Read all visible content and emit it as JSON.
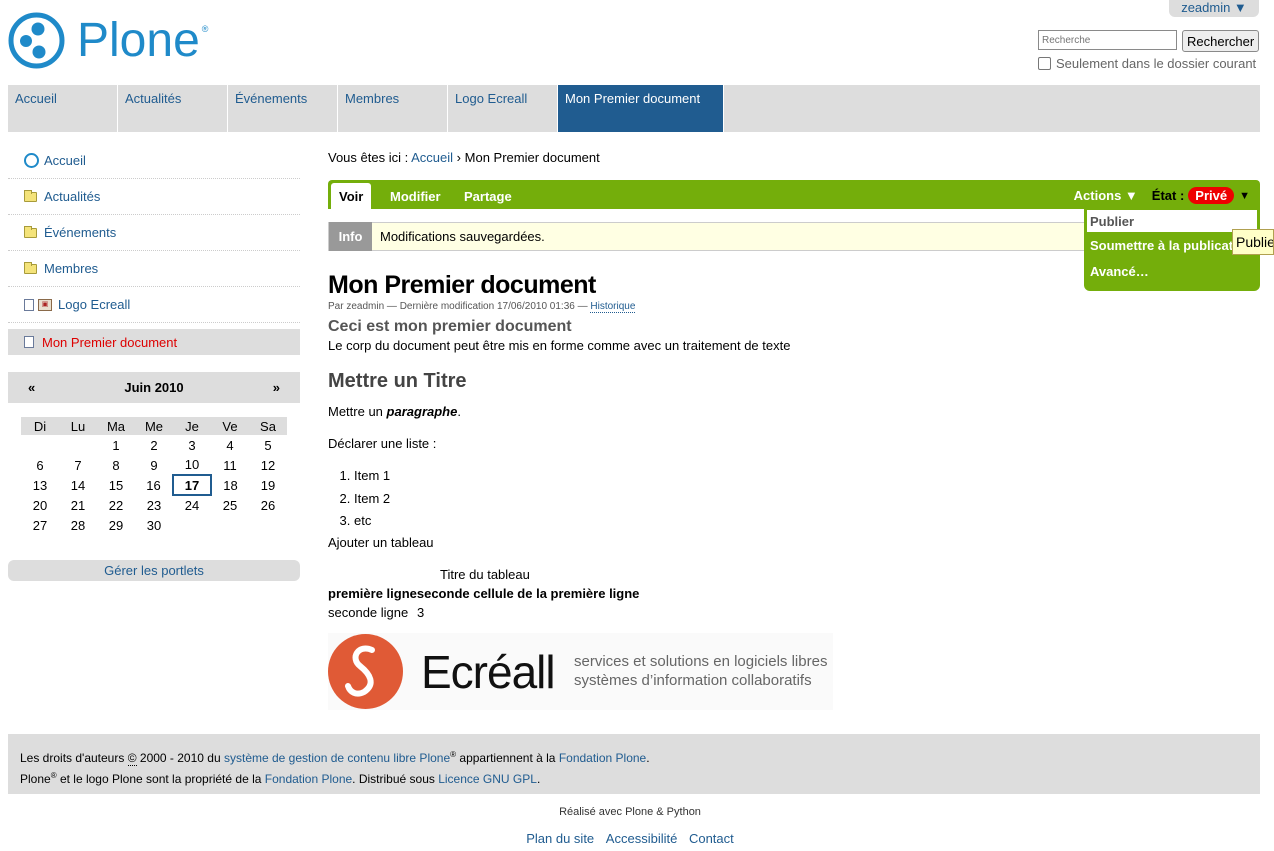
{
  "header": {
    "logo_text": "Plone",
    "logo_reg": "®",
    "user_menu": "zeadmin ▼",
    "search_placeholder": "Recherche",
    "search_button": "Rechercher",
    "search_option": "Seulement dans le dossier courant"
  },
  "globalnav": {
    "tabs": [
      {
        "label": "Accueil"
      },
      {
        "label": "Actualités"
      },
      {
        "label": "Événements"
      },
      {
        "label": "Membres"
      },
      {
        "label": "Logo Ecreall"
      },
      {
        "label": "Mon Premier document"
      }
    ]
  },
  "leftnav": {
    "items": [
      {
        "label": "Accueil",
        "icon": "plone-icon"
      },
      {
        "label": "Actualités",
        "icon": "folder-icon"
      },
      {
        "label": "Événements",
        "icon": "folder-icon"
      },
      {
        "label": "Membres",
        "icon": "folder-icon"
      },
      {
        "label": "Logo Ecreall",
        "icon": "image-icon"
      },
      {
        "label": "Mon Premier document",
        "icon": "document-icon"
      }
    ]
  },
  "calendar": {
    "prev": "«",
    "next": "»",
    "month": "Juin 2010",
    "days": [
      "Di",
      "Lu",
      "Ma",
      "Me",
      "Je",
      "Ve",
      "Sa"
    ],
    "weeks": [
      [
        "",
        "",
        "1",
        "2",
        "3",
        "4",
        "5"
      ],
      [
        "6",
        "7",
        "8",
        "9",
        "10",
        "11",
        "12"
      ],
      [
        "13",
        "14",
        "15",
        "16",
        "17",
        "18",
        "19"
      ],
      [
        "20",
        "21",
        "22",
        "23",
        "24",
        "25",
        "26"
      ],
      [
        "27",
        "28",
        "29",
        "30",
        "",
        "",
        ""
      ]
    ],
    "today": "17"
  },
  "manage_portlets": "Gérer les portlets",
  "breadcrumb": {
    "prefix": "Vous êtes ici :",
    "home": "Accueil",
    "sep": "›",
    "current": "Mon Premier document"
  },
  "contentbar": {
    "tabs": [
      "Voir",
      "Modifier",
      "Partage"
    ],
    "actions": "Actions ▼",
    "state_label": "État :",
    "state_value": "Privé",
    "state_caret": "▼",
    "menu": [
      "Publier",
      "Soumettre à la publication",
      "Avancé…"
    ],
    "tooltip": "Publier"
  },
  "message": {
    "tag": "Info",
    "text": "Modifications sauvegardées."
  },
  "document": {
    "title": "Mon Premier document",
    "byline_prefix": "Par zeadmin — Dernière modification 17/06/2010 01:36 —",
    "history": "Historique",
    "description": "Ceci est mon premier document",
    "intro": "Le corp du document peut être mis en forme comme avec un traitement de texte",
    "heading": "Mettre un Titre",
    "para_prefix": "Mettre un",
    "para_em": "paragraphe",
    "para_suffix": ".",
    "list_intro": "Déclarer une liste :",
    "list": [
      "Item 1",
      "Item 2",
      "etc"
    ],
    "table_intro": "Ajouter un tableau",
    "table_caption": "Titre du tableau",
    "table_row1": "première ligneseconde cellule de la première ligne",
    "table_row2_a": "seconde ligne",
    "table_row2_b": "3",
    "ecreall_name": "Ecréall",
    "ecreall_tag1": "services et solutions en logiciels libres",
    "ecreall_tag2": "systèmes d’information collaboratifs"
  },
  "footer": {
    "line1_a": "Les droits d'auteurs",
    "copyright": "©",
    "line1_b": "2000 - 2010 du",
    "line1_link": "système de gestion de contenu libre Plone",
    "reg": "®",
    "line1_c": "appartiennent à la",
    "line1_link2": "Fondation Plone",
    "line1_end": ".",
    "line2_a": "Plone",
    "line2_b": "et le logo Plone sont la propriété de la",
    "line2_link": "Fondation Plone",
    "line2_c": ". Distribué sous",
    "line2_link2": "Licence GNU GPL",
    "line2_end": ".",
    "colophon": "Réalisé avec Plone & Python",
    "site_actions": [
      "Plan du site",
      "Accessibilité",
      "Contact"
    ]
  },
  "colors": {
    "brand": "#1f8ac9",
    "link": "#205c90",
    "content_bar": "#74ae0b",
    "state_private": "#e00000"
  }
}
